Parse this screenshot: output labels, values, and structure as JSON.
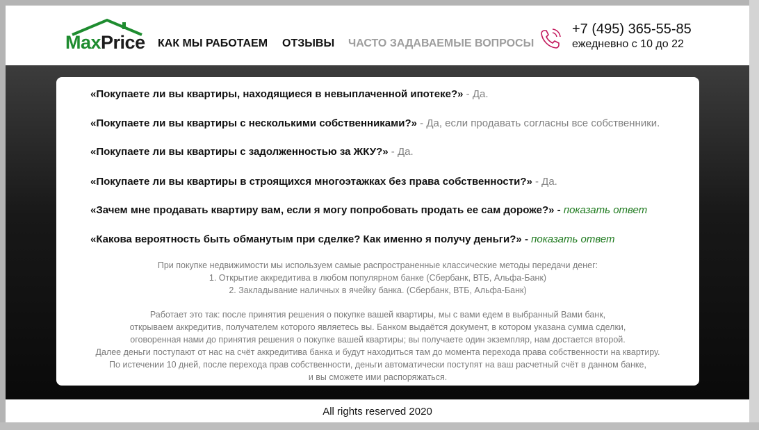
{
  "header": {
    "logo": {
      "max": "Max",
      "price": "Price"
    },
    "nav": [
      {
        "label": "КАК МЫ РАБОТАЕМ"
      },
      {
        "label": "ОТЗЫВЫ"
      },
      {
        "label": "ЧАСТО ЗАДАВАЕМЫЕ ВОПРОСЫ"
      }
    ],
    "phone_icon": "phone-icon",
    "phone": "+7 (495) 365-55-85",
    "hours": "ежедневно с 10 до 22"
  },
  "faq": [
    {
      "question": "«Покупаете ли вы квартиры, находящиеся в невыплаченной ипотеке?»",
      "separator": " - ",
      "answer": "Да."
    },
    {
      "question": "«Покупаете ли вы квартиры с несколькими собственниками?»",
      "separator": " - ",
      "answer": "Да, если продавать согласны все собственники."
    },
    {
      "question": "«Покупаете ли вы квартиры с задолженностью за ЖКУ?»",
      "separator": " - ",
      "answer": "Да."
    },
    {
      "question": "«Покупаете ли вы квартиры в строящихся многоэтажках без права собственности?»",
      "separator": " - ",
      "answer": "Да."
    },
    {
      "question": "«Зачем мне продавать квартиру вам, если я могу попробовать продать ее сам дороже?»",
      "separator": " - ",
      "link": "показать ответ"
    },
    {
      "question": "«Какова вероятность быть обманутым при сделке? Как именно я получу деньги?»",
      "separator": " - ",
      "link": "показать ответ"
    }
  ],
  "details": {
    "methods": [
      "При покупке недвижимости мы используем самые распространенные классические методы передачи денег:",
      "1. Открытие аккредитива в любом популярном банке (Сбербанк, ВТБ, Альфа-Банк)",
      "2. Закладывание наличных в ячейку банка. (Сбербанк, ВТБ, Альфа-Банк)"
    ],
    "process": [
      "Работает это так: после принятия решения о покупке вашей квартиры, мы с вами едем в выбранный Вами банк,",
      "открываем аккредитив, получателем которого являетесь вы. Банком выдаётся документ, в котором указана сумма сделки,",
      "оговоренная нами до принятия решения о покупке вашей квартиры; вы получаете один экземпляр, нам достается второй.",
      "Далее деньги поступают от нас на счёт аккредитива банка и будут находиться там до момента перехода права собственности на квартиру.",
      "По истечении 10 дней, после перехода прав собственности, деньги автоматически поступят на ваш расчетный счёт в данном банке,",
      "и вы сможете ими распоряжаться."
    ]
  },
  "footer": {
    "text": "All rights reserved 2020"
  },
  "colors": {
    "brand_green": "#1e8c2f",
    "link_green": "#1f7a1f",
    "phone_icon": "#c2185b",
    "muted": "#808080"
  }
}
